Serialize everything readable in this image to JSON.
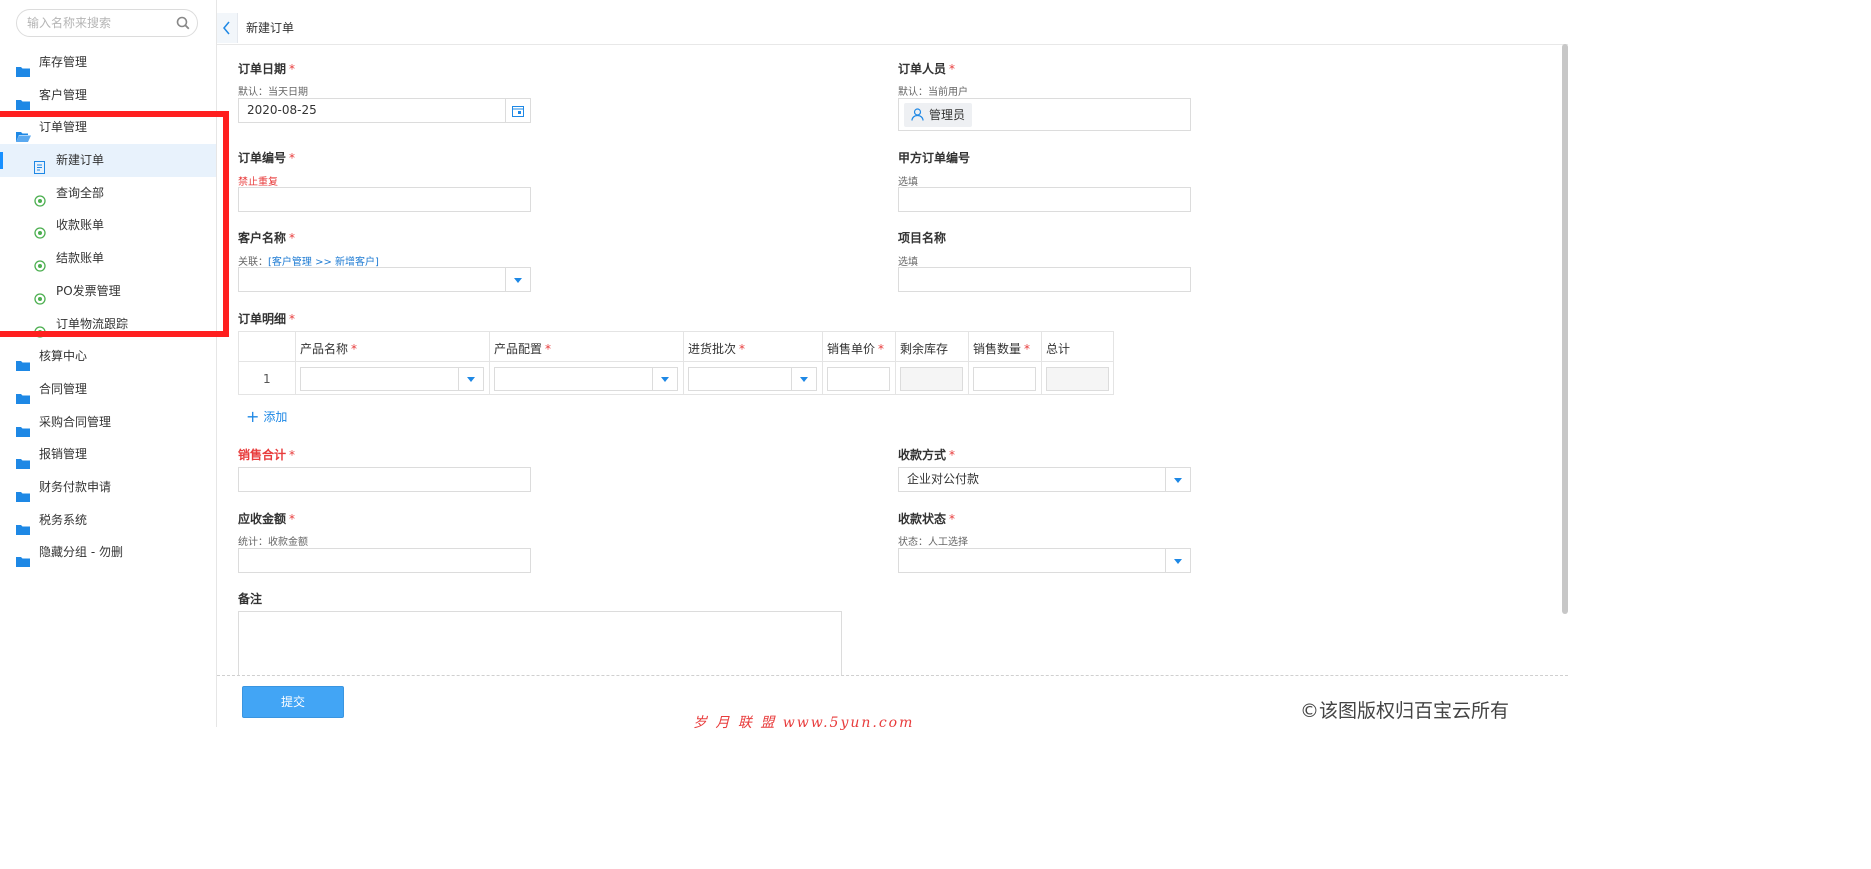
{
  "sidebar": {
    "search_placeholder": "输入名称来搜索",
    "items": [
      {
        "label": "库存管理"
      },
      {
        "label": "客户管理"
      },
      {
        "label": "订单管理"
      },
      {
        "label": "新建订单"
      },
      {
        "label": "查询全部"
      },
      {
        "label": "收款账单"
      },
      {
        "label": "结款账单"
      },
      {
        "label": "PO发票管理"
      },
      {
        "label": "订单物流跟踪"
      },
      {
        "label": "核算中心"
      },
      {
        "label": "合同管理"
      },
      {
        "label": "采购合同管理"
      },
      {
        "label": "报销管理"
      },
      {
        "label": "财务付款申请"
      },
      {
        "label": "税务系统"
      },
      {
        "label": "隐藏分组 - 勿删"
      }
    ]
  },
  "header": {
    "title": "新建订单"
  },
  "form": {
    "order_date": {
      "label": "订单日期",
      "hint": "默认：当天日期",
      "value": "2020-08-25"
    },
    "order_person": {
      "label": "订单人员",
      "hint": "默认：当前用户",
      "value": "管理员"
    },
    "order_no": {
      "label": "订单编号",
      "hint": "禁止重复",
      "value": ""
    },
    "party_a_no": {
      "label": "甲方订单编号",
      "hint": "选填",
      "value": ""
    },
    "customer": {
      "label": "客户名称",
      "hint_prefix": "关联：",
      "hint_link": "[客户管理 >> 新增客户]",
      "value": ""
    },
    "project": {
      "label": "项目名称",
      "hint": "选填",
      "value": ""
    },
    "details": {
      "label": "订单明细",
      "columns": [
        "产品名称",
        "产品配置",
        "进货批次",
        "销售单价",
        "剩余库存",
        "销售数量",
        "总计"
      ],
      "row_number": "1",
      "add_label": "添加"
    },
    "sales_total": {
      "label": "销售合计",
      "value": ""
    },
    "payment_method": {
      "label": "收款方式",
      "value": "企业对公付款"
    },
    "receivable": {
      "label": "应收金额",
      "hint": "统计：收款金额",
      "value": ""
    },
    "payment_status": {
      "label": "收款状态",
      "hint": "状态：人工选择",
      "value": ""
    },
    "remark": {
      "label": "备注",
      "value": ""
    },
    "required_mark": "*"
  },
  "footer": {
    "submit_label": "提交",
    "watermark_left": "岁 月 联 盟  www.5yun.com",
    "watermark_right": "©该图版权归百宝云所有"
  },
  "colors": {
    "accent": "#1e88e5",
    "required": "#e83c3c",
    "highlight_box": "#ff1f1f",
    "submit": "#42a5f5"
  }
}
